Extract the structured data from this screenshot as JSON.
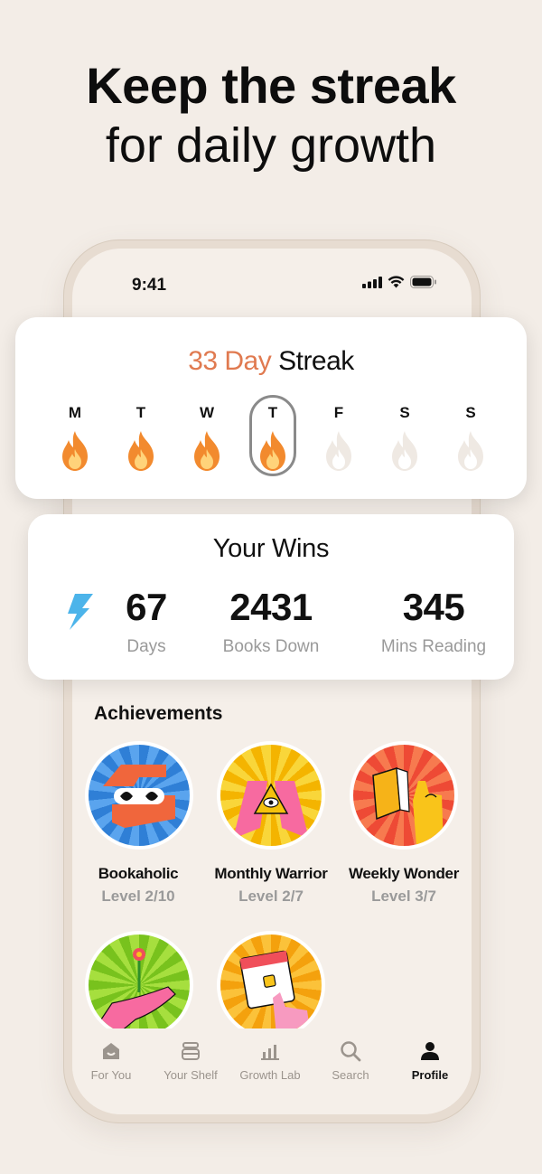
{
  "headline": {
    "line1": "Keep the streak",
    "line2": "for daily growth"
  },
  "status_bar": {
    "time": "9:41"
  },
  "streak": {
    "count_text": "33 Day",
    "suffix": "Streak",
    "days": [
      {
        "letter": "M",
        "done": true
      },
      {
        "letter": "T",
        "done": true
      },
      {
        "letter": "W",
        "done": true
      },
      {
        "letter": "T",
        "done": true,
        "today": true
      },
      {
        "letter": "F",
        "done": false
      },
      {
        "letter": "S",
        "done": false
      },
      {
        "letter": "S",
        "done": false
      }
    ],
    "colors": {
      "accent": "#e07a50",
      "flame": "#f28a2e",
      "flame_inactive": "#efe9e3"
    }
  },
  "wins": {
    "title": "Your Wins",
    "stats": [
      {
        "value": "67",
        "label": "Days",
        "icon": "lightning-icon"
      },
      {
        "value": "2431",
        "label": "Books Down"
      },
      {
        "value": "345",
        "label": "Mins Reading"
      }
    ]
  },
  "achievements": {
    "title": "Achievements",
    "items": [
      {
        "name": "Bookaholic",
        "level": "Level 2/10",
        "icon": "eyes-hands-icon",
        "color": "#3d8fe0"
      },
      {
        "name": "Monthly Warrior",
        "level": "Level 2/7",
        "icon": "triangle-eye-icon",
        "color": "#f6c21b"
      },
      {
        "name": "Weekly Wonder",
        "level": "Level 3/7",
        "icon": "book-hand-icon",
        "color": "#f05a3c"
      },
      {
        "name": "",
        "level": "",
        "icon": "flower-hand-icon",
        "color": "#8ccf2a"
      },
      {
        "name": "",
        "level": "",
        "icon": "calendar-hand-icon",
        "color": "#f7a81b"
      }
    ]
  },
  "tabbar": {
    "tabs": [
      {
        "label": "For You",
        "icon": "home-icon",
        "active": false
      },
      {
        "label": "Your Shelf",
        "icon": "shelf-icon",
        "active": false
      },
      {
        "label": "Growth Lab",
        "icon": "chart-icon",
        "active": false
      },
      {
        "label": "Search",
        "icon": "search-icon",
        "active": false
      },
      {
        "label": "Profile",
        "icon": "profile-icon",
        "active": true
      }
    ]
  }
}
